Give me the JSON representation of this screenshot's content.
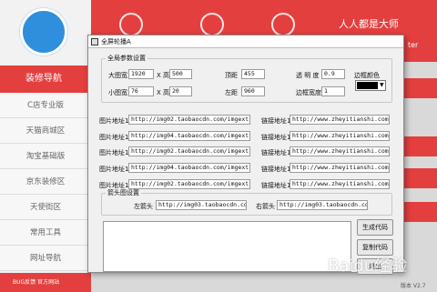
{
  "app": {
    "brand": "人人都是大师",
    "nav_active": "装修导航",
    "nav_items": [
      "C店专业版",
      "天猫商城区",
      "淘宝基础版",
      "京东装修区",
      "天使街区",
      "常用工具",
      "网址导航"
    ],
    "bottom_left": "BUG反馈   官方网站",
    "version": "版本 V2.7",
    "right_text": "ter",
    "watermark": "Baidu经验"
  },
  "dialog": {
    "title": "全屏轮播A",
    "global_group": "全局参数设置",
    "big_w_label": "大图宽",
    "big_w": "1920",
    "big_h_label": "X 高",
    "big_h": "500",
    "top_label": "顶距",
    "top": "455",
    "alpha_label": "透 明 度",
    "alpha": "0.9",
    "border_color_label": "边框颜色",
    "small_w_label": "小图宽",
    "small_w": "76",
    "small_h_label": "X 高",
    "small_h": "20",
    "left_label": "左距",
    "left": "960",
    "border_w_label": "边框宽度",
    "border_w": "1",
    "rows": [
      {
        "img_label": "图片地址1",
        "img": "http://img02.taobaocdn.com/imgextra/i2/10",
        "link_label": "链接地址1",
        "link": "http://www.zheyitianshi.com/"
      },
      {
        "img_label": "图片地址1",
        "img": "http://img04.taobaocdn.com/imgextra/i4/10",
        "link_label": "链接地址1",
        "link": "http://www.zheyitianshi.com/"
      },
      {
        "img_label": "图片地址1",
        "img": "http://img02.taobaocdn.com/imgextra/i2/10",
        "link_label": "链接地址1",
        "link": "http://www.zheyitianshi.com/"
      },
      {
        "img_label": "图片地址1",
        "img": "http://img04.taobaocdn.com/imgextra/i4/10",
        "link_label": "链接地址1",
        "link": "http://www.zheyitianshi.com/"
      },
      {
        "img_label": "图片地址1",
        "img": "http://img02.taobaocdn.com/imgextra/i2/10",
        "link_label": "链接地址1",
        "link": "http://www.zheyitianshi.com/"
      }
    ],
    "arrow_group": "箭头图设置",
    "left_arrow_label": "左箭头",
    "left_arrow": "http://img03.taobaocdn.com/img",
    "right_arrow_label": "右箭头",
    "right_arrow": "http://img03.taobaocdn.com/img",
    "gen_button": "生成代码",
    "copy_button": "复制代码",
    "exit_button": "退出"
  }
}
